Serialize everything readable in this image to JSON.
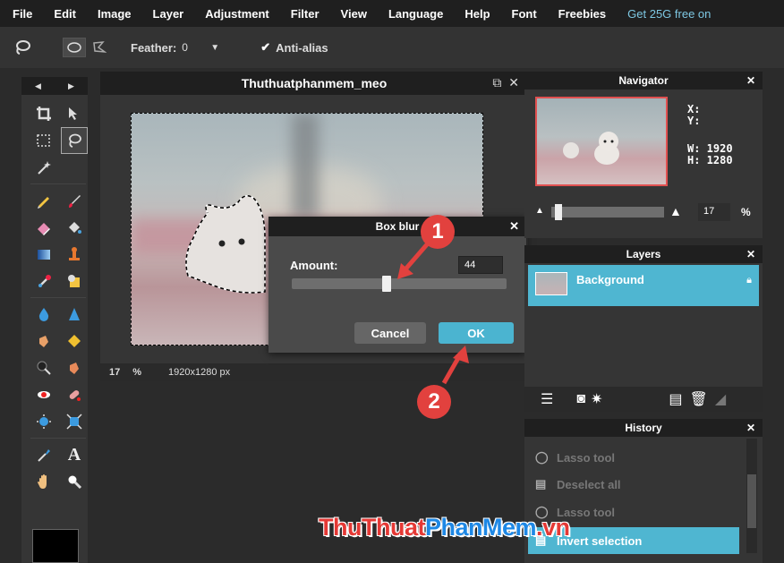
{
  "menu": {
    "items": [
      "File",
      "Edit",
      "Image",
      "Layer",
      "Adjustment",
      "Filter",
      "View",
      "Language",
      "Help",
      "Font",
      "Freebies"
    ],
    "promo": "Get 25G free on"
  },
  "options": {
    "feather_label": "Feather:",
    "feather_value": "0",
    "antialias_checked": "✔",
    "antialias_label": "Anti-alias"
  },
  "tools": {
    "nav_left": "◀",
    "nav_right": "▶"
  },
  "document": {
    "title": "Thuthuatphanmem_meo",
    "zoom": "17",
    "zoom_unit": "%",
    "size": "1920x1280 px"
  },
  "dialog": {
    "title": "Box blur",
    "amount_label": "Amount:",
    "amount_value": "44",
    "amount_fraction": 0.44,
    "cancel_label": "Cancel",
    "ok_label": "OK"
  },
  "markers": {
    "one": "1",
    "two": "2"
  },
  "navigator": {
    "title": "Navigator",
    "xy": "X:\nY:",
    "w": "W: 1920",
    "h": "H: 1280",
    "zoom": "17",
    "zoom_unit": "%"
  },
  "layers": {
    "title": "Layers",
    "items": [
      {
        "name": "Background"
      }
    ]
  },
  "history": {
    "title": "History",
    "items": [
      "Lasso tool",
      "Deselect all",
      "Lasso tool",
      "Invert selection"
    ]
  },
  "watermark": {
    "part1": "ThuThuat",
    "part2": "PhanMem",
    "part3": ".vn"
  },
  "colors": {
    "accent": "#4fb6d1",
    "marker": "#e2413e",
    "promo": "#7ec8e3"
  }
}
